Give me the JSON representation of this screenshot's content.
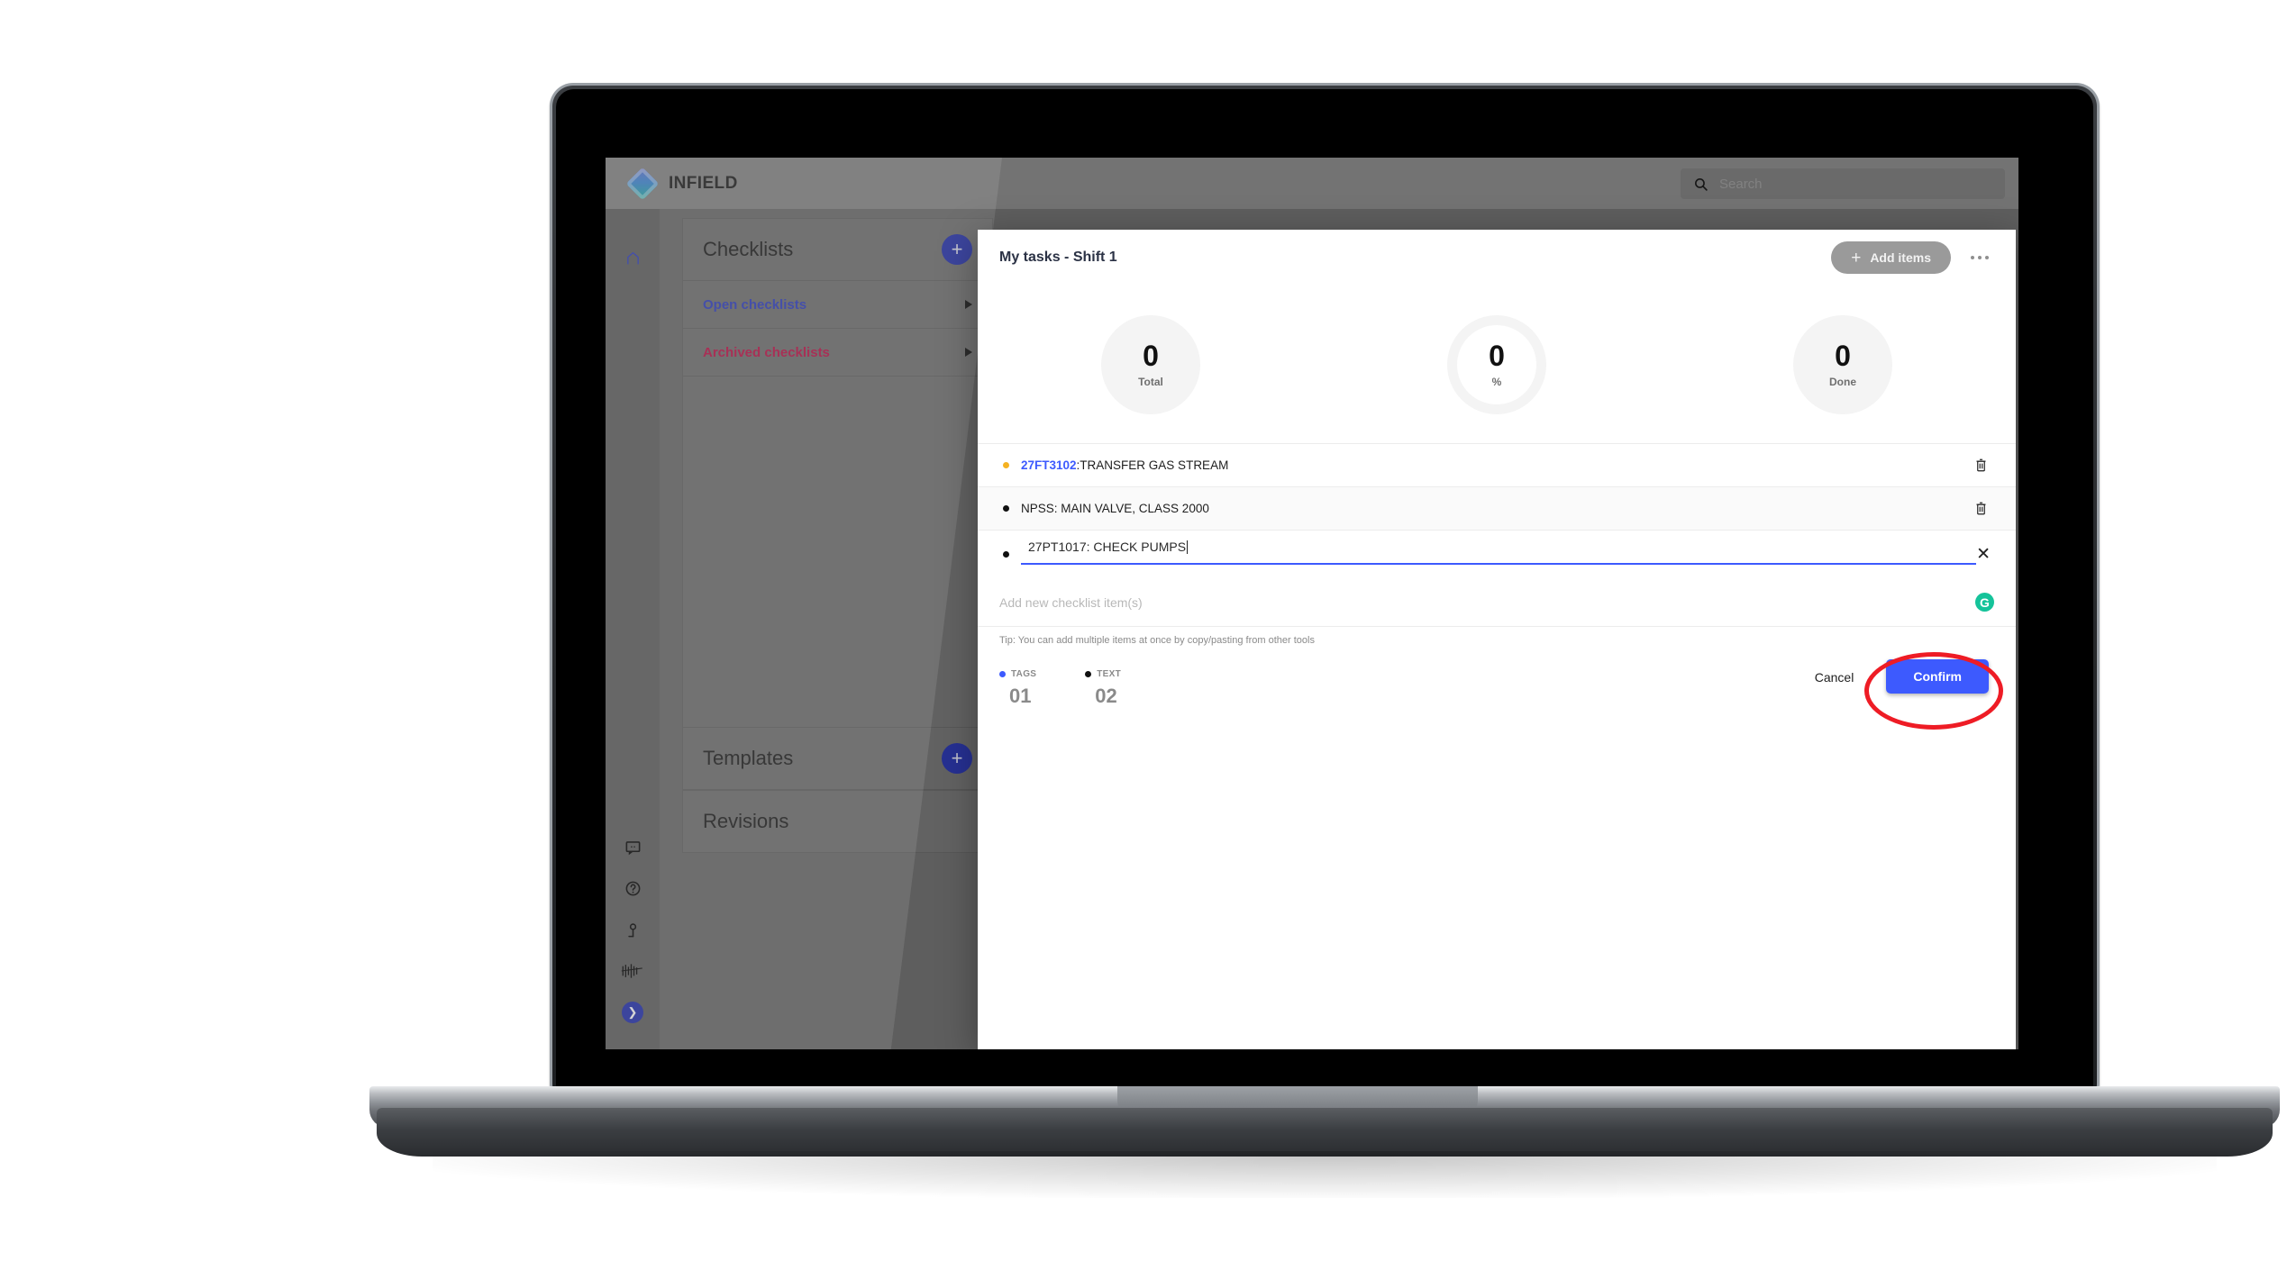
{
  "app": {
    "brand_name": "INFIELD",
    "search_placeholder": "Search"
  },
  "sidebar": {
    "rail_icons": [
      "home-icon",
      "chat-icon",
      "help-icon",
      "user-icon",
      "data-icon",
      "expand-icon"
    ],
    "panels": [
      {
        "title": "Checklists",
        "add_label": "+",
        "rows": [
          {
            "label": "Open checklists",
            "style": "blue"
          },
          {
            "label": "Archived checklists",
            "style": "pink"
          }
        ]
      },
      {
        "title": "Templates",
        "add_label": "+",
        "rows": []
      },
      {
        "title": "Revisions",
        "add_label": "",
        "rows": []
      }
    ]
  },
  "modal": {
    "title": "My tasks - Shift 1",
    "add_items_label": "Add items",
    "more_label": "…",
    "stats": [
      {
        "value": "0",
        "label": "Total",
        "style": "solid"
      },
      {
        "value": "0",
        "label": "%",
        "style": "ring"
      },
      {
        "value": "0",
        "label": "Done",
        "style": "solid"
      }
    ],
    "items": [
      {
        "bullet": "amber",
        "tag": "27FT3102",
        "text": ":TRANSFER GAS STREAM",
        "action": "trash",
        "state": "normal"
      },
      {
        "bullet": "dark",
        "tag": "",
        "text": "NPSS: MAIN VALVE, CLASS 2000",
        "action": "trash",
        "state": "alt"
      },
      {
        "bullet": "dark",
        "tag": "",
        "text": "27PT1017: CHECK PUMPS",
        "action": "close",
        "state": "editing"
      }
    ],
    "add_new_placeholder": "Add new checklist item(s)",
    "grammarly_glyph": "G",
    "tip": "Tip: You can add multiple items at once by copy/pasting from other tools",
    "counters": [
      {
        "label": "TAGS",
        "value": "01",
        "color": "#3d5afe"
      },
      {
        "label": "TEXT",
        "value": "02",
        "color": "#111111"
      }
    ],
    "cancel_label": "Cancel",
    "confirm_label": "Confirm"
  },
  "colors": {
    "accent_blue": "#3d5afe",
    "brand_indigo": "#2f3bb3",
    "highlight_red": "#ee1c25",
    "amber": "#f5b222",
    "grammarly_green": "#15c39a",
    "archived_pink": "#c21f52"
  }
}
